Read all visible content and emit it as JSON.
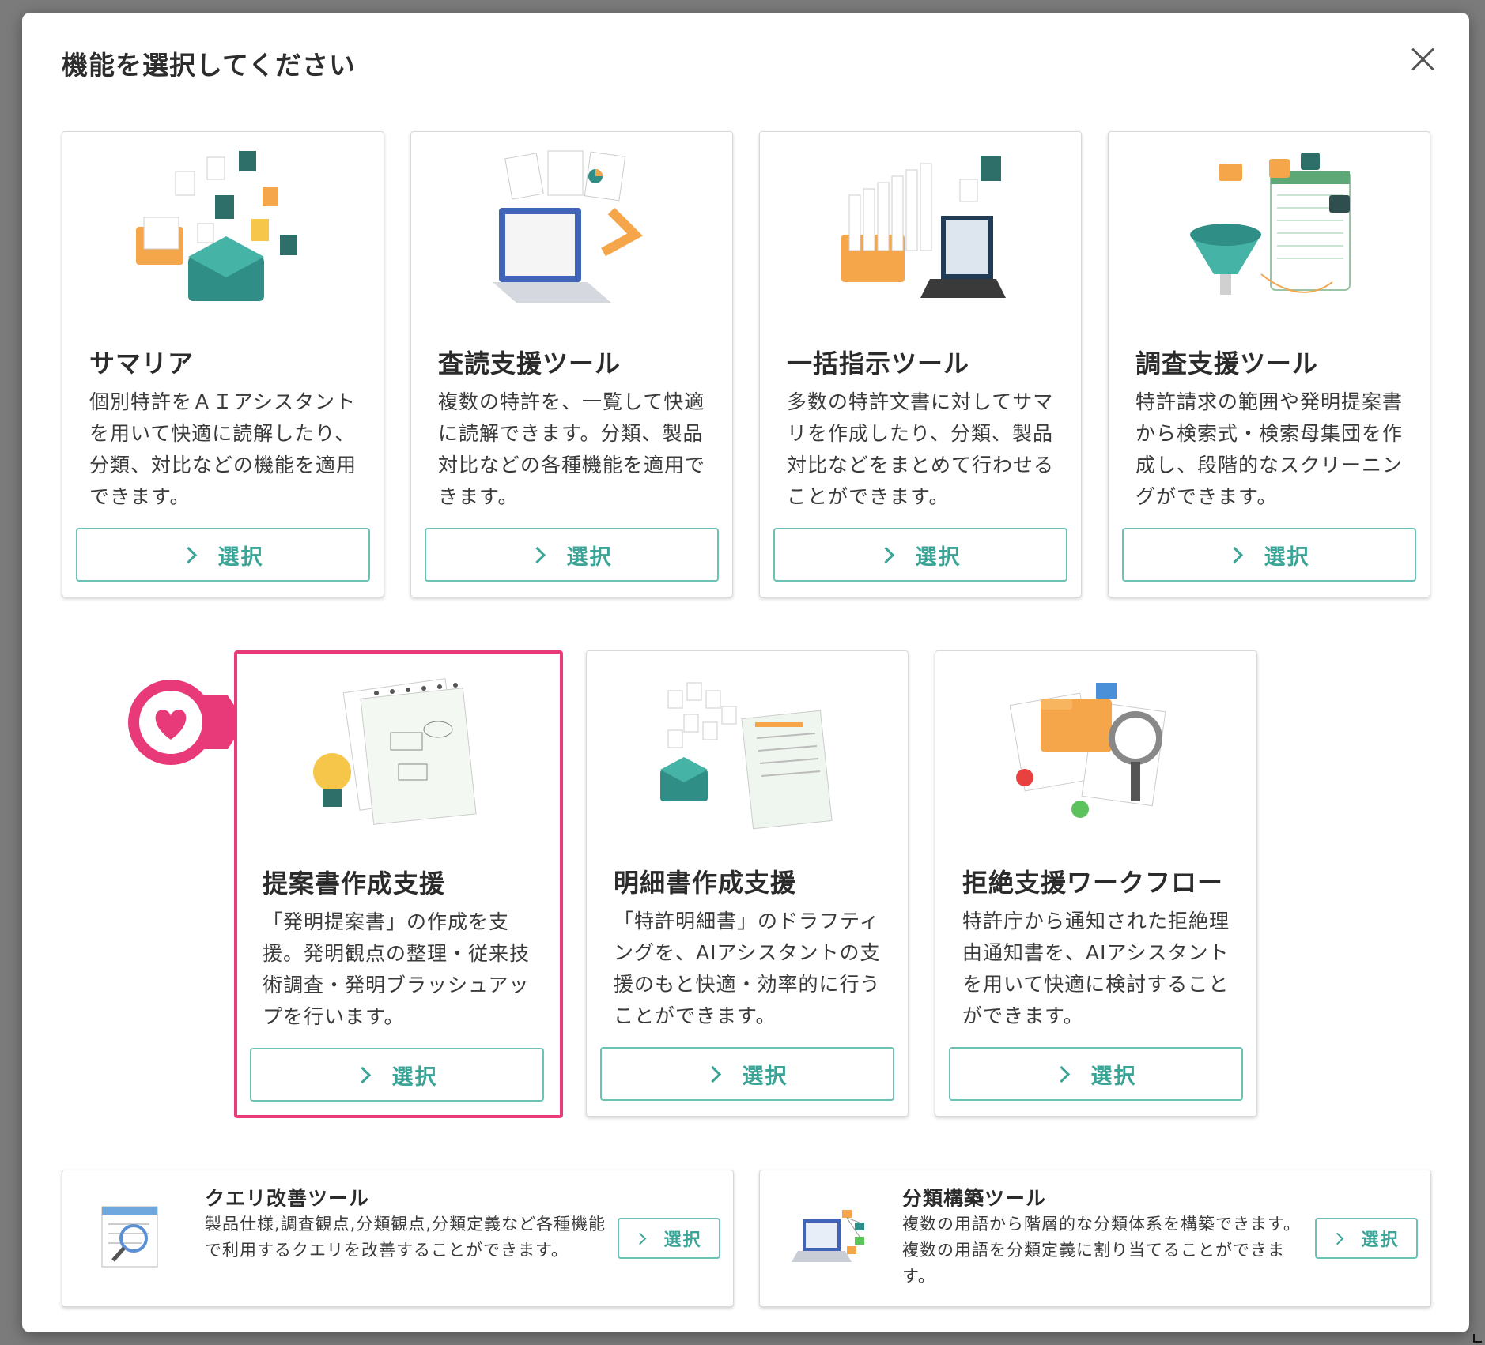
{
  "dialog": {
    "title": "機能を選択してください",
    "close_icon": "close-icon"
  },
  "colors": {
    "accent": "#3aa597",
    "button_border": "#6cc3b5",
    "highlight": "#e83a79",
    "backdrop": "#7b7b7b"
  },
  "cards": [
    {
      "title": "サマリア",
      "desc": "個別特許をＡＩアシスタントを用いて快適に読解したり、分類、対比などの機能を適用できます。",
      "button": "選択",
      "illustration": "summaria-illustration"
    },
    {
      "title": "査読支援ツール",
      "desc": "複数の特許を、一覧して快適に読解できます。分類、製品対比などの各種機能を適用できます。",
      "button": "選択",
      "illustration": "laptop-documents-illustration"
    },
    {
      "title": "一括指示ツール",
      "desc": "多数の特許文書に対してサマリを作成したり、分類、製品対比などをまとめて行わせることができます。",
      "button": "選択",
      "illustration": "folders-laptop-illustration"
    },
    {
      "title": "調査支援ツール",
      "desc": "特許請求の範囲や発明提案書から検索式・検索母集団を作成し、段階的なスクリーニングができます。",
      "button": "選択",
      "illustration": "funnel-search-illustration"
    },
    {
      "title": "提案書作成支援",
      "desc": "「発明提案書」の作成を支援。発明観点の整理・従来技術調査・発明ブラッシュアップを行います。",
      "button": "選択",
      "illustration": "lightbulb-notepad-illustration",
      "highlighted": true,
      "badge_icon": "heart-icon"
    },
    {
      "title": "明細書作成支援",
      "desc": "「特許明細書」のドラフティングを、AIアシスタントの支援のもと快適・効率的に行うことができます。",
      "button": "選択",
      "illustration": "scroll-documents-illustration"
    },
    {
      "title": "拒絶支援ワークフロー",
      "desc": "特許庁から通知された拒絶理由通知書を、AIアシスタントを用いて快適に検討することができます。",
      "button": "選択",
      "illustration": "folder-magnifier-illustration"
    }
  ],
  "small_cards": [
    {
      "title": "クエリ改善ツール",
      "desc": "製品仕様,調査観点,分類観点,分類定義など各種機能で利用するクエリを改善することができます。",
      "button": "選択",
      "illustration": "query-magnifier-illustration"
    },
    {
      "title": "分類構築ツール",
      "desc": "複数の用語から階層的な分類体系を構築できます。複数の用語を分類定義に割り当てることができます。",
      "button": "選択",
      "illustration": "laptop-tree-illustration"
    }
  ]
}
